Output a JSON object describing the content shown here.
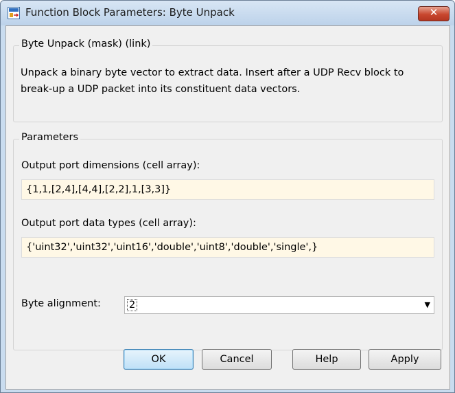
{
  "window": {
    "title": "Function Block Parameters: Byte Unpack",
    "close_label": "✕"
  },
  "description_group": {
    "legend": "Byte Unpack (mask) (link)",
    "text": "Unpack a binary byte vector to extract data. Insert after a UDP Recv block to break-up a UDP packet into its constituent data vectors."
  },
  "parameters": {
    "legend": "Parameters",
    "dims_label": "Output port dimensions (cell array):",
    "dims_value": "{1,1,[2,4],[4,4],[2,2],1,[3,3]}",
    "types_label": "Output port data types (cell array):",
    "types_value": "{'uint32','uint32','uint16','double','uint8','double','single',}",
    "alignment_label": "Byte alignment:",
    "alignment_value": "2"
  },
  "buttons": {
    "ok": "OK",
    "cancel": "Cancel",
    "help": "Help",
    "apply": "Apply"
  }
}
